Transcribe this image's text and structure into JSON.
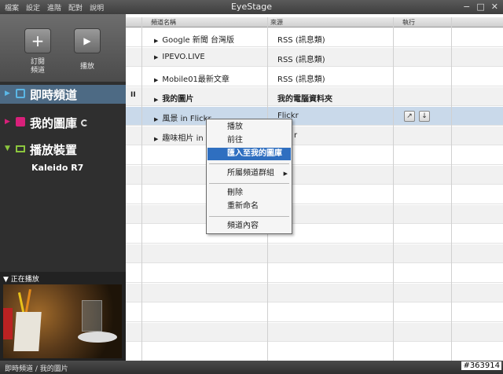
{
  "window": {
    "title": "EyeStage",
    "menu": [
      "檔案",
      "設定",
      "進階",
      "配對",
      "說明"
    ],
    "min_glyph": "−",
    "max_glyph": "□",
    "close_glyph": "✕"
  },
  "sidebar": {
    "subscribe_glyph": "+",
    "subscribe_label": "訂閱\n頻道",
    "play_glyph": "▶",
    "play_label": "播放",
    "nav": {
      "live": "即時頻道",
      "library": "我的圖庫",
      "devices": "播放裝置"
    },
    "device_name": "Kaleido R7",
    "now_playing_label": "▼ 正在播放"
  },
  "table": {
    "columns": [
      "頻道名稱",
      "來源",
      "執行"
    ],
    "rows": [
      {
        "name": "Google 新聞 台灣版",
        "source": "RSS (訊息類)"
      },
      {
        "name": "IPEVO.LIVE",
        "source": "RSS (訊息類)"
      },
      {
        "name": "Mobile01最新文章",
        "source": "RSS (訊息類)"
      },
      {
        "name": "我的圖片",
        "source": "我的電腦資料夾",
        "playing_mark": "II"
      },
      {
        "name": "風景 in Flickr",
        "source": "Flickr",
        "selected": true
      },
      {
        "name": "趣味相片 in F",
        "source": "r"
      }
    ],
    "action_icons": [
      "open-external-icon",
      "download-icon"
    ],
    "action_glyphs": [
      "↗",
      "↓"
    ]
  },
  "context_menu": {
    "items": [
      "播放",
      "前往",
      "匯入至我的圖庫",
      "所屬頻道群組",
      "刪除",
      "重新命名",
      "頻道內容"
    ],
    "highlighted": "匯入至我的圖庫",
    "submenu_glyph": "▶"
  },
  "status": {
    "path": "即時頻道 / 我的圖片",
    "watermark": "#363914"
  },
  "colors": {
    "accent_live": "#5bb7e6",
    "accent_library": "#d8207a",
    "accent_devices": "#8cc63e",
    "menu_highlight": "#2f6fc0",
    "selected_row": "#c9d9ea"
  }
}
